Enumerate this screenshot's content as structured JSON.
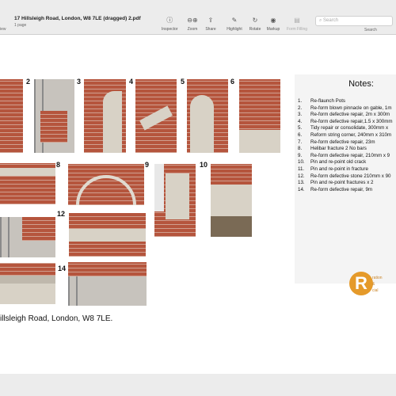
{
  "window": {
    "title": "17 Hillsleigh Road, London, W8 7LE (dragged) 2.pdf",
    "subtitle": "1 page",
    "view_label": "iew"
  },
  "toolbar": {
    "inspector": "Inspector",
    "zoom": "Zoom",
    "share": "Share",
    "highlight": "Highlight",
    "rotate": "Rotate",
    "markup": "Markup",
    "form_filling": "Form Filling",
    "search_placeholder": "Search",
    "search_label": "Search"
  },
  "photo_numbers": [
    "2",
    "3",
    "4",
    "5",
    "6",
    "8",
    "9",
    "10",
    "12",
    "14"
  ],
  "notes": {
    "title": "Notes:",
    "items": [
      {
        "n": "1.",
        "text": "Re-flaunch Pots"
      },
      {
        "n": "2.",
        "text": "Re-form blown pinnacle on gable, 1m"
      },
      {
        "n": "3.",
        "text": "Re-form defective repair, 2m x 300m"
      },
      {
        "n": "4.",
        "text": "Re-form defective repair,1.5 x 300mm"
      },
      {
        "n": "5.",
        "text": "Tidy repair or consolidate, 300mm x"
      },
      {
        "n": "6.",
        "text": "Reform string corner, 240mm x 310m"
      },
      {
        "n": "7.",
        "text": "Re-form defective repair,  23m"
      },
      {
        "n": "8.",
        "text": "Helibar fracture 2 No bars"
      },
      {
        "n": "9.",
        "text": "Re-form defective repair, 210mm x 9"
      },
      {
        "n": "10.",
        "text": "Pin and re-point old crack"
      },
      {
        "n": "11.",
        "text": "Pin and re-point in fracture"
      },
      {
        "n": "12.",
        "text": "Re-form defective stone 210mm x 90"
      },
      {
        "n": "13.",
        "text": "Pin and re-point fractures x 2"
      },
      {
        "n": "14.",
        "text": "Re-form defective repair,  9m"
      }
    ]
  },
  "logo": {
    "letter": "R",
    "line1": "ration",
    "line2": "&",
    "line3": "cial"
  },
  "address": "illsleigh Road, London, W8 7LE."
}
